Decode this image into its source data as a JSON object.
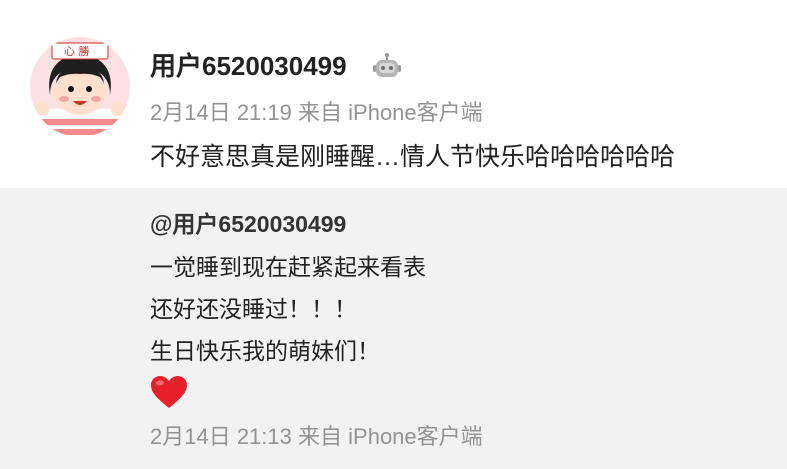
{
  "post": {
    "avatar_icon": "user-avatar-cartoon",
    "username": "用户6520030499",
    "badge_icon": "robot-badge-icon",
    "time": "2月14日 21:19",
    "source_prefix": "来自",
    "source": "iPhone客户端",
    "text": "不好意思真是刚睡醒…情人节快乐哈哈哈哈哈哈"
  },
  "repost": {
    "username": "@用户6520030499",
    "lines": [
      "一觉睡到现在赶紧起来看表",
      "还好还没睡过！！！",
      "生日快乐我的萌妹们！"
    ],
    "emoji_icon": "red-heart-icon",
    "time": "2月14日 21:13",
    "source_prefix": "来自",
    "source": "iPhone客户端"
  },
  "colors": {
    "text": "#222222",
    "meta": "#939393",
    "repost_bg": "#f2f2f2",
    "heart": "#e8202b"
  }
}
